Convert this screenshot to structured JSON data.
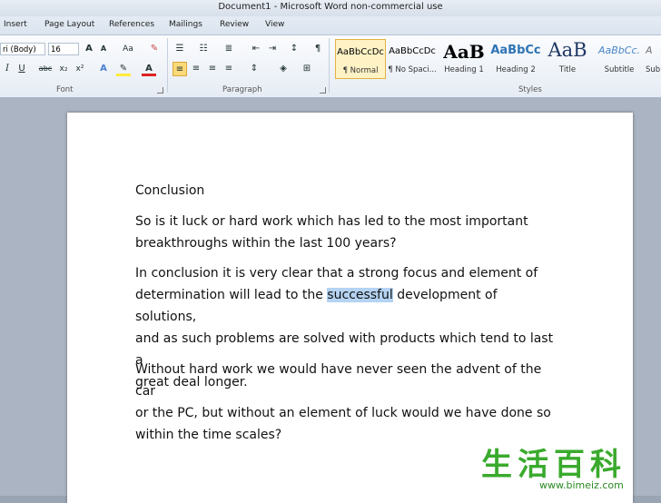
{
  "window": {
    "title": "Document1  -  Microsoft Word non-commercial use"
  },
  "tabs": [
    "Insert",
    "Page Layout",
    "References",
    "Mailings",
    "Review",
    "View"
  ],
  "font_group": {
    "font_name": "ri (Body)",
    "font_size": "16",
    "label": "Font",
    "grow_label": "A",
    "case_label": "Aa",
    "italic": "I",
    "underline": "U",
    "strike": "abc",
    "subscript": "x₂",
    "superscript": "x²"
  },
  "paragraph_group": {
    "label": "Paragraph"
  },
  "styles_group": {
    "label": "Styles",
    "items": [
      {
        "preview": "AaBbCcDc",
        "name": "¶ Normal"
      },
      {
        "preview": "AaBbCcDc",
        "name": "¶ No Spaci..."
      },
      {
        "preview": "AaB",
        "name": "Heading 1"
      },
      {
        "preview": "AaBbCc",
        "name": "Heading 2"
      },
      {
        "preview": "AaB",
        "name": "Title"
      },
      {
        "preview": "AaBbCc.",
        "name": "Subtitle"
      },
      {
        "preview": "A",
        "name": "Sub"
      }
    ]
  },
  "document": {
    "heading": "Conclusion",
    "p1_l1": "So is it luck or hard work which has led to the most important",
    "p1_l2": "breakthroughs within the last 100 years?",
    "p2_l1": "In conclusion it is very clear that a strong focus and element of",
    "p2_l2_before": "determination will lead to the ",
    "p2_l2_selected": "successful",
    "p2_l2_after": " development of solutions,",
    "p2_l3": "and as such problems are solved with products which tend to last a",
    "p2_l4": "great deal longer.",
    "p3_l1": "Without hard work we would have never seen the advent of the car",
    "p3_l2": "or the PC, but without an element of luck would we have done so",
    "p3_l3": "within the time scales?"
  },
  "watermark": {
    "chars": "生活百科",
    "url": "www.bimeiz.com"
  },
  "colors": {
    "selection": "#b5d3f3",
    "ribbon_active": "#fbd979",
    "watermark_green": "#3aaa2d"
  }
}
